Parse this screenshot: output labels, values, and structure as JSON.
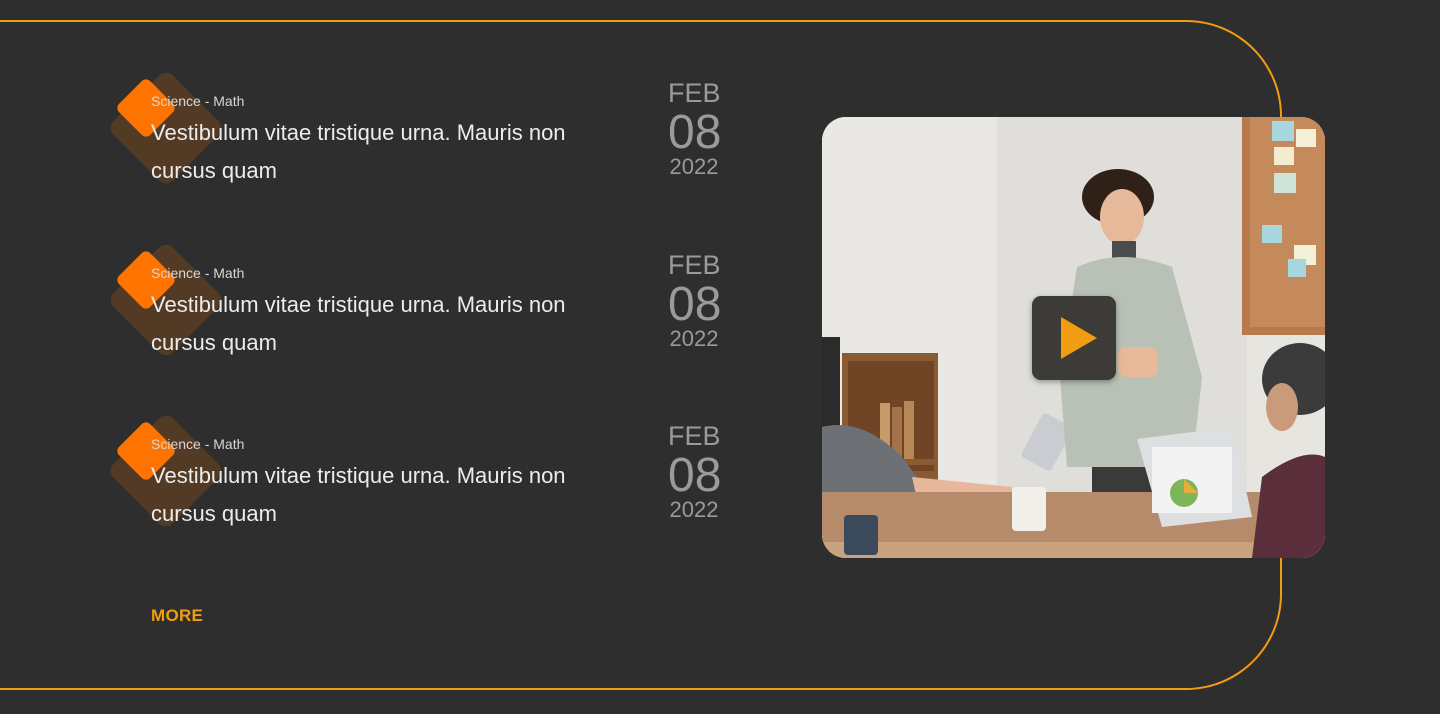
{
  "news": {
    "items": [
      {
        "category": "Science - Math",
        "title": "Vestibulum vitae tristique urna. Mauris non cursus quam",
        "month": "FEB",
        "day": "08",
        "year": "2022"
      },
      {
        "category": "Science - Math",
        "title": "Vestibulum vitae tristique urna. Mauris non cursus quam",
        "month": "FEB",
        "day": "08",
        "year": "2022"
      },
      {
        "category": "Science - Math",
        "title": "Vestibulum vitae tristique urna. Mauris non cursus quam",
        "month": "FEB",
        "day": "08",
        "year": "2022"
      }
    ],
    "more_label": "MORE"
  },
  "video": {
    "play_icon": "play-icon"
  },
  "colors": {
    "background": "#2e2e2e",
    "accent": "#f29c11",
    "category_diamond": "#ff7300",
    "title_text": "#ececec",
    "date_text": "#9a9a9a"
  }
}
